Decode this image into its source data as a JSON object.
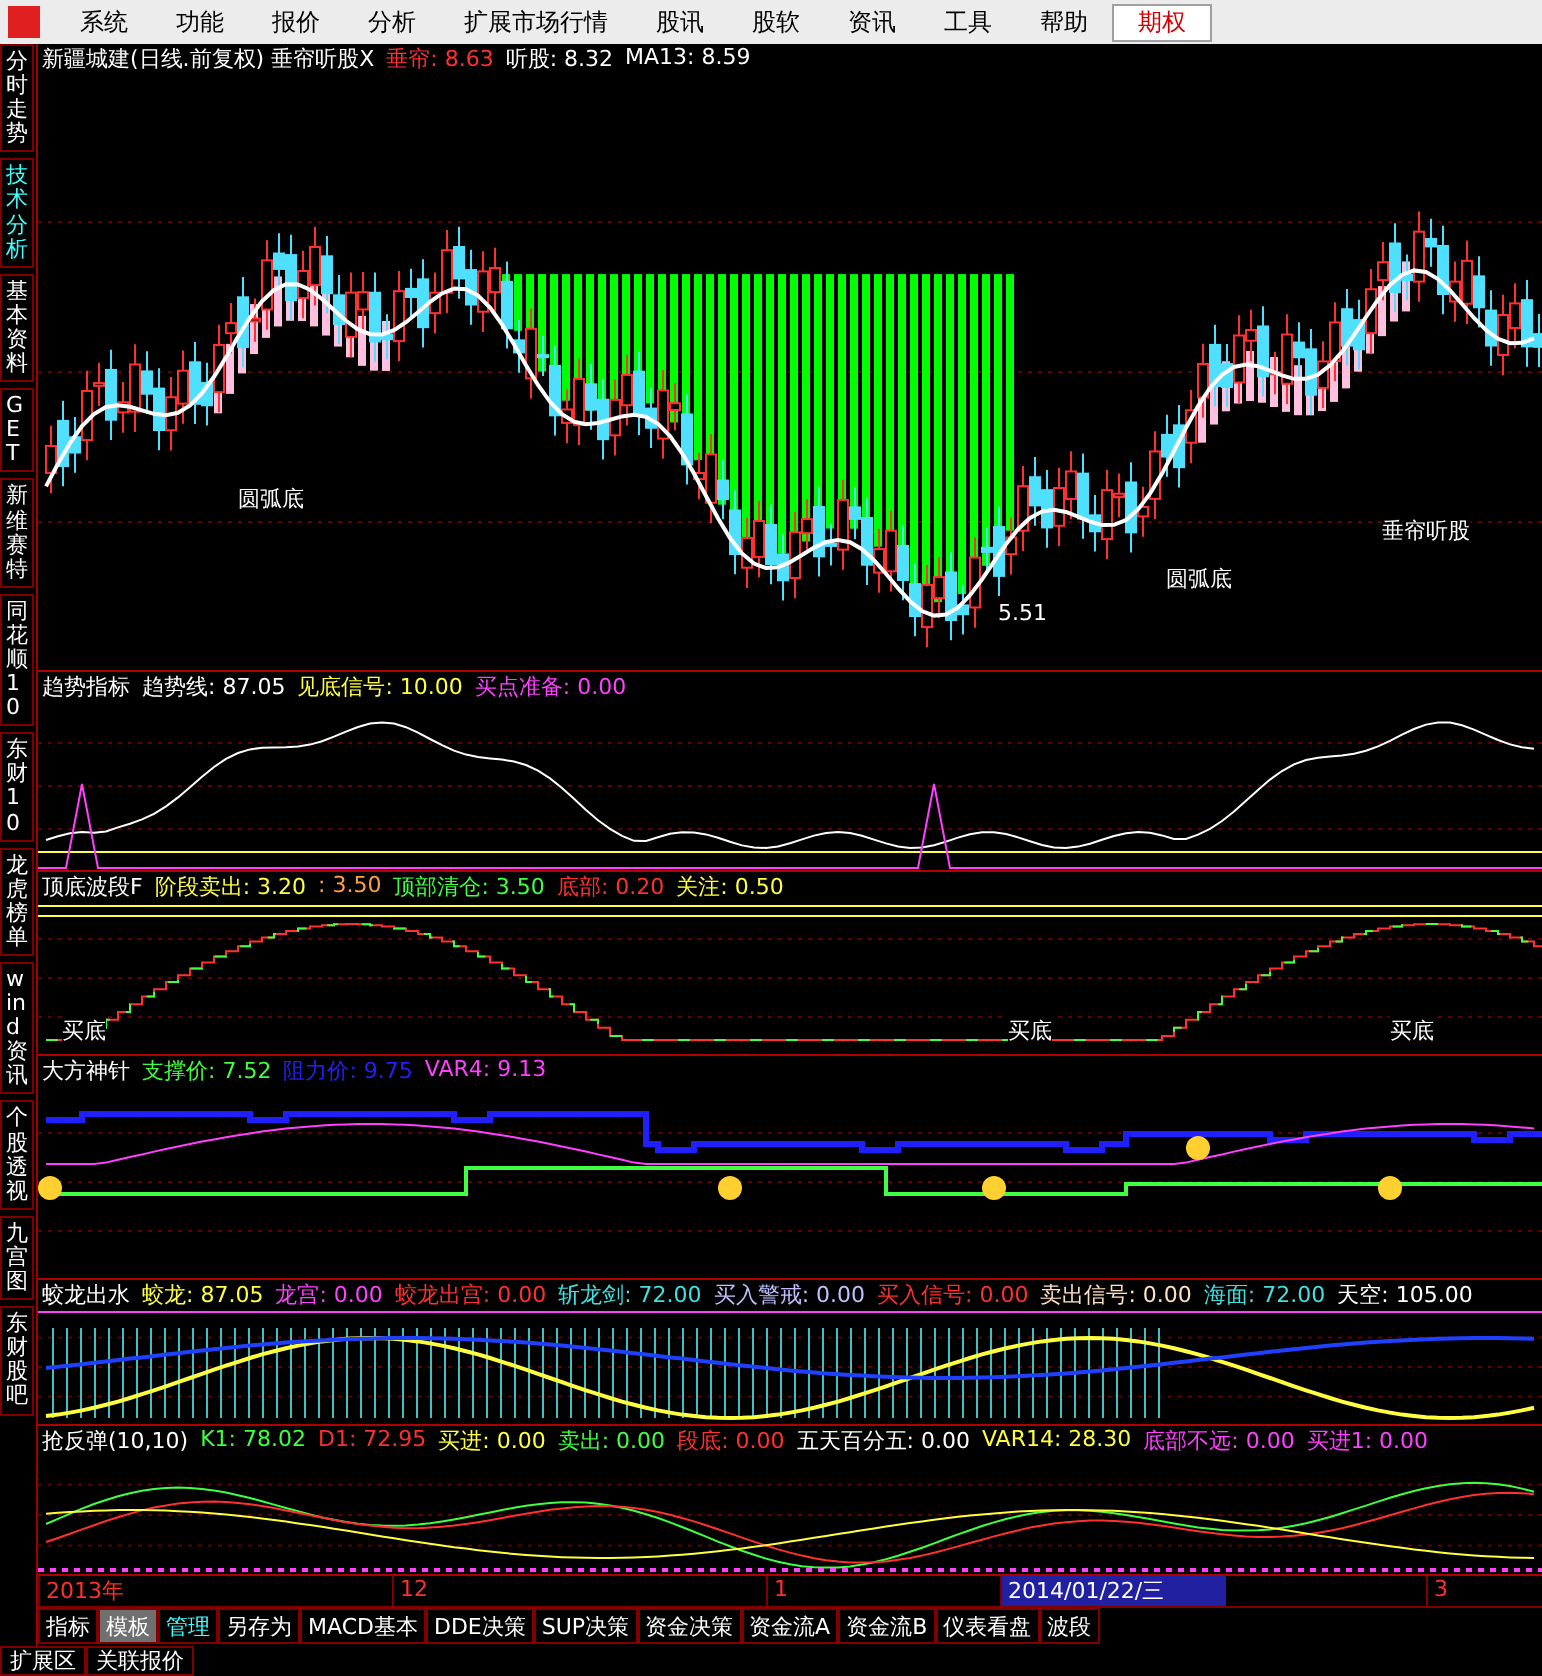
{
  "menu": [
    {
      "label": "系统",
      "highlighted": false
    },
    {
      "label": "功能",
      "highlighted": false
    },
    {
      "label": "报价",
      "highlighted": false
    },
    {
      "label": "分析",
      "highlighted": false
    },
    {
      "label": "扩展市场行情",
      "highlighted": false
    },
    {
      "label": "股讯",
      "highlighted": false
    },
    {
      "label": "股软",
      "highlighted": false
    },
    {
      "label": "资讯",
      "highlighted": false
    },
    {
      "label": "工具",
      "highlighted": false
    },
    {
      "label": "帮助",
      "highlighted": false
    },
    {
      "label": "期权",
      "highlighted": true
    }
  ],
  "side_tabs": [
    {
      "label": "分时走势",
      "selected": false
    },
    {
      "label": "技术分析",
      "selected": true
    },
    {
      "label": "基本资料",
      "selected": false
    },
    {
      "label": "GET",
      "selected": false
    },
    {
      "label": "新维赛特",
      "selected": false
    },
    {
      "label": "同花顺10",
      "selected": false
    },
    {
      "label": "东财10",
      "selected": false
    },
    {
      "label": "龙虎榜单",
      "selected": false
    },
    {
      "label": "wind资讯",
      "selected": false
    },
    {
      "label": "个股透视",
      "selected": false
    },
    {
      "label": "九宫图",
      "selected": false
    },
    {
      "label": "东财股吧",
      "selected": false
    }
  ],
  "panels": [
    {
      "kind": "candles",
      "legend": [
        {
          "text": "新疆城建(日线.前复权) 垂帘听股X",
          "color": "#ffffff"
        },
        {
          "text": "垂帘: 8.63",
          "color": "#ff3030"
        },
        {
          "text": "听股: 8.32",
          "color": "#ffffff"
        },
        {
          "text": "MA13: 8.59",
          "color": "#ffffff"
        }
      ],
      "labels": [
        "圆弧底",
        "圆弧底",
        "5.51",
        "垂帘听股"
      ]
    },
    {
      "kind": "trend",
      "legend": [
        {
          "text": "趋势指标",
          "color": "#ffffff"
        },
        {
          "text": "趋势线: 87.05",
          "color": "#ffffff"
        },
        {
          "text": "见底信号: 10.00",
          "color": "#ffff40"
        },
        {
          "text": "买点准备: 0.00",
          "color": "#ff40ff"
        }
      ]
    },
    {
      "kind": "steps",
      "legend": [
        {
          "text": "顶底波段F",
          "color": "#ffffff"
        },
        {
          "text": "阶段卖出: 3.20",
          "color": "#ffff40"
        },
        {
          "text": ": 3.50",
          "color": "#ffa040"
        },
        {
          "text": "顶部清仓: 3.50",
          "color": "#40ff40"
        },
        {
          "text": "底部: 0.20",
          "color": "#ff3030"
        },
        {
          "text": "关注: 0.50",
          "color": "#ffff40"
        }
      ],
      "labels": [
        "买底",
        "买底",
        "买底"
      ]
    },
    {
      "kind": "needle",
      "legend": [
        {
          "text": "大方神针",
          "color": "#ffffff"
        },
        {
          "text": "支撑价: 7.52",
          "color": "#40ff40"
        },
        {
          "text": "阻力价: 9.75",
          "color": "#2020ff"
        },
        {
          "text": "VAR4: 9.13",
          "color": "#ff40ff"
        }
      ]
    },
    {
      "kind": "dragon",
      "legend": [
        {
          "text": "蛟龙出水",
          "color": "#ffffff"
        },
        {
          "text": "蛟龙: 87.05",
          "color": "#ffff40"
        },
        {
          "text": "龙宫: 0.00",
          "color": "#ff40ff"
        },
        {
          "text": "蛟龙出宫: 0.00",
          "color": "#ff3030"
        },
        {
          "text": "斩龙剑: 72.00",
          "color": "#40e0e0"
        },
        {
          "text": "买入警戒: 0.00",
          "color": "#c0c0ff"
        },
        {
          "text": "买入信号: 0.00",
          "color": "#ff3030"
        },
        {
          "text": "卖出信号: 0.00",
          "color": "#ffe0c0"
        },
        {
          "text": "海面: 72.00",
          "color": "#40e0e0"
        },
        {
          "text": "天空: 105.00",
          "color": "#ffffff"
        }
      ]
    },
    {
      "kind": "rebound",
      "legend": [
        {
          "text": "抢反弹(10,10)",
          "color": "#ffffff"
        },
        {
          "text": "K1: 78.02",
          "color": "#40ff40"
        },
        {
          "text": "D1: 72.95",
          "color": "#ff3030"
        },
        {
          "text": "买进: 0.00",
          "color": "#ffff40"
        },
        {
          "text": "卖出: 0.00",
          "color": "#40ff40"
        },
        {
          "text": "段底: 0.00",
          "color": "#ff3030"
        },
        {
          "text": "五天百分五: 0.00",
          "color": "#ffffff"
        },
        {
          "text": "VAR14: 28.30",
          "color": "#ffff40"
        },
        {
          "text": "底部不远: 0.00",
          "color": "#ff40ff"
        },
        {
          "text": "买进1: 0.00",
          "color": "#ff40ff"
        }
      ]
    }
  ],
  "axis": [
    {
      "label": "2013年",
      "selected": false
    },
    {
      "label": "12",
      "selected": false
    },
    {
      "label": "1",
      "selected": false
    },
    {
      "label": "2014/01/22/三",
      "selected": true
    },
    {
      "label": "3",
      "selected": false
    }
  ],
  "bottom_tabs": [
    {
      "label": "指标",
      "selected": false,
      "accent": false
    },
    {
      "label": "模板",
      "selected": true,
      "accent": false
    },
    {
      "label": "管理",
      "selected": false,
      "accent": true
    },
    {
      "label": "另存为",
      "selected": false,
      "accent": false
    },
    {
      "label": "MACD基本",
      "selected": false,
      "accent": false
    },
    {
      "label": "DDE决策",
      "selected": false,
      "accent": false
    },
    {
      "label": "SUP决策",
      "selected": false,
      "accent": false
    },
    {
      "label": "资金决策",
      "selected": false,
      "accent": false
    },
    {
      "label": "资金流A",
      "selected": false,
      "accent": false
    },
    {
      "label": "资金流B",
      "selected": false,
      "accent": false
    },
    {
      "label": "仪表看盘",
      "selected": false,
      "accent": false
    },
    {
      "label": "波段",
      "selected": false,
      "accent": false
    }
  ],
  "bottom_strip": [
    "扩展区",
    "关联报价"
  ]
}
